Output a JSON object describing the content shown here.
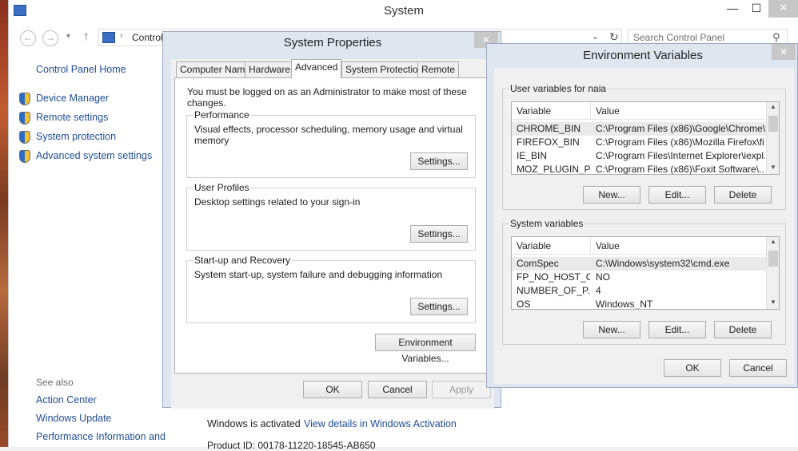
{
  "system_window": {
    "title": "System",
    "controls": {
      "minimize": "—",
      "maximize": "☐",
      "close": "✕"
    },
    "address": {
      "crumb": "Control",
      "sep": "›"
    },
    "search": {
      "placeholder": "Search Control Panel"
    },
    "left_nav": {
      "home": "Control Panel Home",
      "items": [
        "Device Manager",
        "Remote settings",
        "System protection",
        "Advanced system settings"
      ],
      "see_also_label": "See also",
      "see_also": [
        "Action Center",
        "Windows Update",
        "Performance Information and"
      ]
    },
    "activation": {
      "status": "Windows is activated",
      "link": "View details in Windows Activation"
    },
    "product_id": "Product ID: 00178-11220-18545-AB650"
  },
  "system_properties": {
    "title": "System Properties",
    "close": "✕",
    "tabs": [
      "Computer Name",
      "Hardware",
      "Advanced",
      "System Protection",
      "Remote"
    ],
    "active_tab": "Advanced",
    "admin_note": "You must be logged on as an Administrator to make most of these changes.",
    "groups": [
      {
        "label": "Performance",
        "desc": "Visual effects, processor scheduling, memory usage and virtual memory",
        "button": "Settings..."
      },
      {
        "label": "User Profiles",
        "desc": "Desktop settings related to your sign-in",
        "button": "Settings..."
      },
      {
        "label": "Start-up and Recovery",
        "desc": "System start-up, system failure and debugging information",
        "button": "Settings..."
      }
    ],
    "env_button": "Environment Variables...",
    "ok": "OK",
    "cancel": "Cancel",
    "apply": "Apply"
  },
  "environment_variables": {
    "title": "Environment Variables",
    "close": "✕",
    "user_section": {
      "label": "User variables for naia",
      "col_variable": "Variable",
      "col_value": "Value",
      "rows": [
        {
          "variable": "CHROME_BIN",
          "value": "C:\\Program Files (x86)\\Google\\Chrome\\..."
        },
        {
          "variable": "FIREFOX_BIN",
          "value": "C:\\Program Files (x86)\\Mozilla Firefox\\fi..."
        },
        {
          "variable": "IE_BIN",
          "value": "C:\\Program Files\\Internet Explorer\\iexpl..."
        },
        {
          "variable": "MOZ_PLUGIN_P...",
          "value": "C:\\Program Files (x86)\\Foxit Software\\..."
        }
      ],
      "buttons": {
        "new": "New...",
        "edit": "Edit...",
        "delete": "Delete"
      }
    },
    "system_section": {
      "label": "System variables",
      "col_variable": "Variable",
      "col_value": "Value",
      "rows": [
        {
          "variable": "ComSpec",
          "value": "C:\\Windows\\system32\\cmd.exe"
        },
        {
          "variable": "FP_NO_HOST_C...",
          "value": "NO"
        },
        {
          "variable": "NUMBER_OF_P...",
          "value": "4"
        },
        {
          "variable": "OS",
          "value": "Windows_NT"
        }
      ],
      "buttons": {
        "new": "New...",
        "edit": "Edit...",
        "delete": "Delete"
      }
    },
    "ok": "OK",
    "cancel": "Cancel"
  }
}
